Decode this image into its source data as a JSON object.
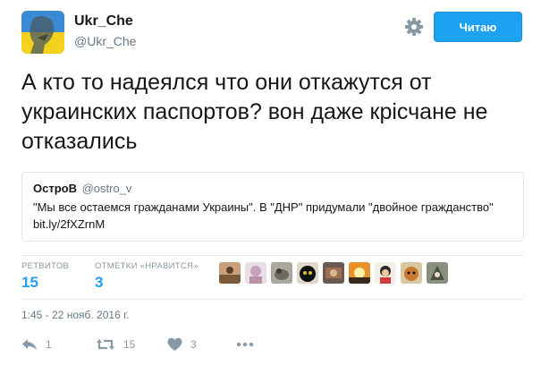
{
  "header": {
    "display_name": "Ukr_Che",
    "handle": "@Ukr_Che",
    "follow_label": "Читаю",
    "avatar_icon": "ukraine-flag-avatar-icon",
    "settings_icon": "gear-icon"
  },
  "tweet": {
    "text": "А кто то надеялся что они откажутся от украинских паспортов? вон даже крісчане не отказались"
  },
  "quote": {
    "author_name": "ОстроВ",
    "author_handle": "@ostro_v",
    "text": "\"Мы все остаемся гражданами Украины\". В \"ДНР\" придумали \"двойное гражданство\" bit.ly/2fXZrnM"
  },
  "stats": {
    "retweets_label": "РЕТВИТОВ",
    "retweets_value": "15",
    "likes_label": "ОТМЕТКИ «НРАВИТСЯ»",
    "likes_value": "3"
  },
  "timestamp": "1:45 - 22 нояб. 2016 г.",
  "actions": {
    "reply_icon": "reply-icon",
    "reply_count": "1",
    "retweet_icon": "retweet-icon",
    "retweet_count": "15",
    "like_icon": "heart-icon",
    "like_count": "3",
    "more_icon": "more-icon"
  },
  "colors": {
    "accent": "#1da1f2",
    "muted": "#657786",
    "border": "#e1e8ed"
  }
}
